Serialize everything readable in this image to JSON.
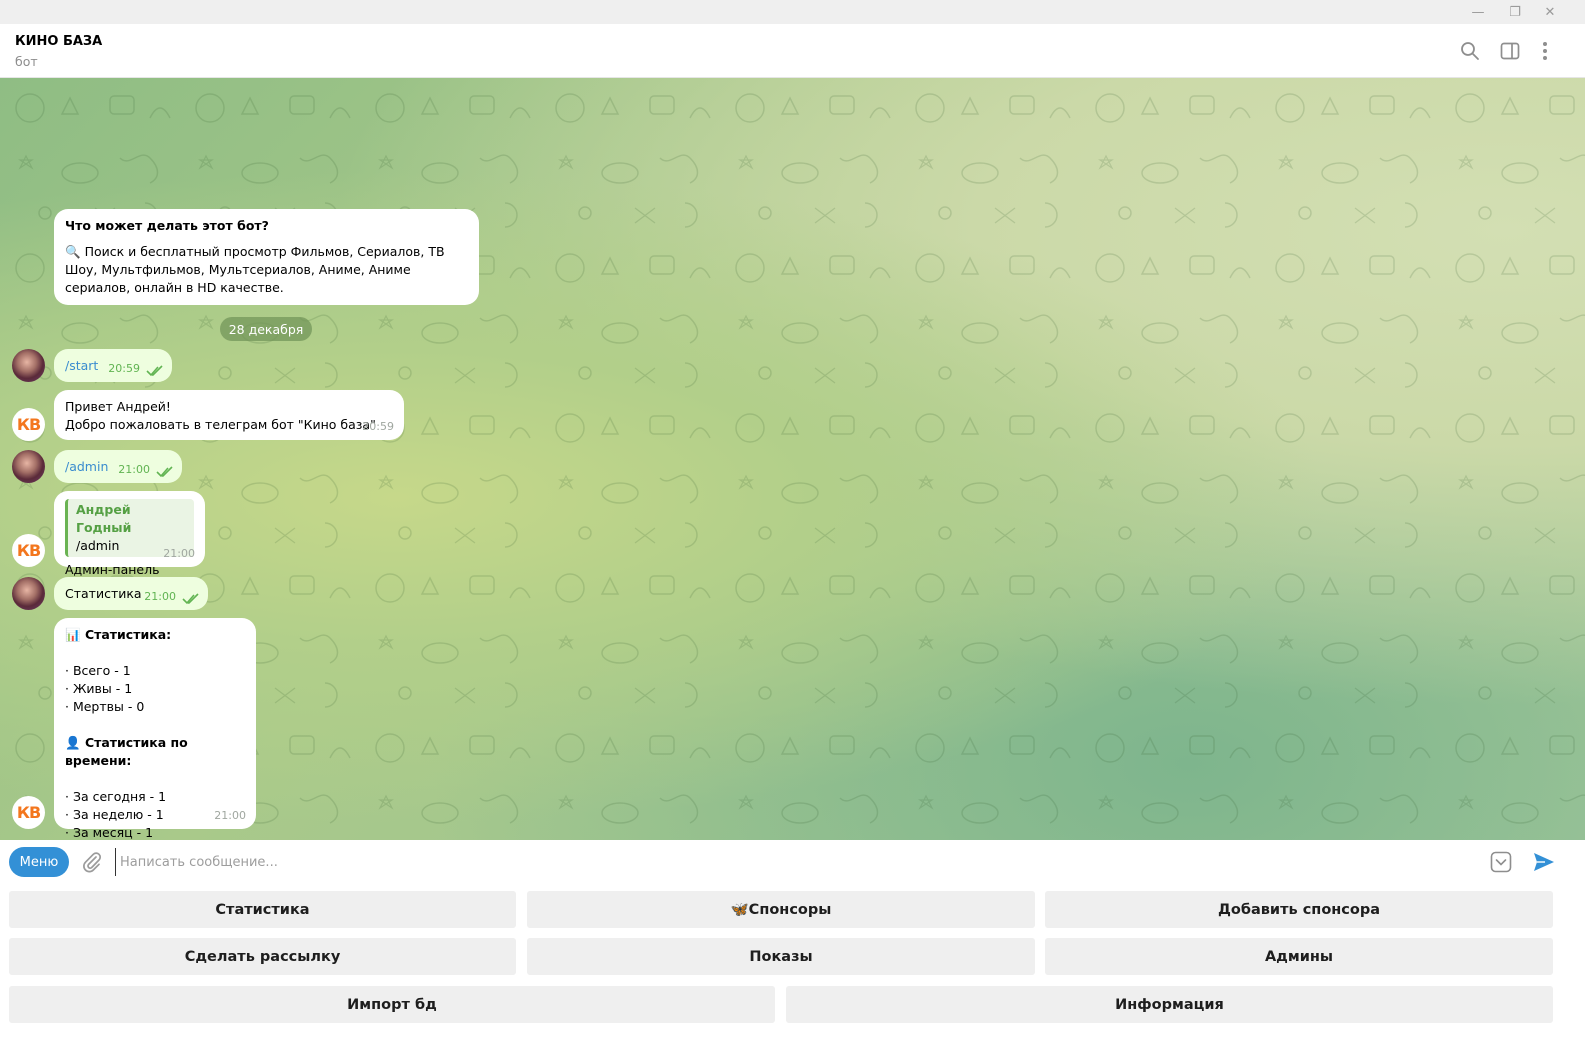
{
  "window": {
    "minimize_glyph": "—",
    "restore_glyph": "❐",
    "close_glyph": "✕"
  },
  "header": {
    "title": "КИНО БАЗА",
    "subtitle": "бот"
  },
  "chat": {
    "intro": {
      "heading": "Что может делать этот бот?",
      "body_icon": "🔍",
      "body": "Поиск и бесплатный просмотр Фильмов, Сериалов, ТВ Шоу, Мультфильмов, Мультсериалов, Аниме, Аниме сериалов, онлайн в HD качестве."
    },
    "date": "28 декабря",
    "messages": [
      {
        "text": "/start",
        "time": "20:59"
      },
      {
        "line1": "Привет Андрей!",
        "line2": "Добро пожаловать в телеграм бот \"Кино база\"",
        "time": "20:59",
        "avatar": "КВ"
      },
      {
        "text": "/admin",
        "time": "21:00"
      },
      {
        "reply_author": "Андрей Годный",
        "reply_text": "/admin",
        "text": "Админ-панель",
        "time": "21:00",
        "avatar": "КВ"
      },
      {
        "text": "Статистика",
        "time": "21:00"
      },
      {
        "heading_icon": "📊",
        "heading": "Статистика:",
        "lines": [
          "· Всего - 1",
          "· Живы - 1",
          "· Мертвы - 0"
        ],
        "heading2_icon": "👤",
        "heading2": "Статистика по времени:",
        "lines2": [
          "· За сегодня - 1",
          "· За неделю - 1",
          "· За месяц - 1"
        ],
        "time": "21:00",
        "avatar": "КВ"
      }
    ]
  },
  "input": {
    "menu_label": "Меню",
    "placeholder": "Написать сообщение..."
  },
  "keyboard": {
    "row1": [
      "Статистика",
      "🦋Спонсоры",
      "Добавить спонсора"
    ],
    "row2": [
      "Сделать рассылку",
      "Показы",
      "Админы"
    ],
    "row3": [
      "Импорт бд",
      "Информация"
    ]
  },
  "colors": {
    "accent": "#3390d6",
    "outgoing_bubble": "#eefedf",
    "bot_avatar": "#f3761e"
  }
}
